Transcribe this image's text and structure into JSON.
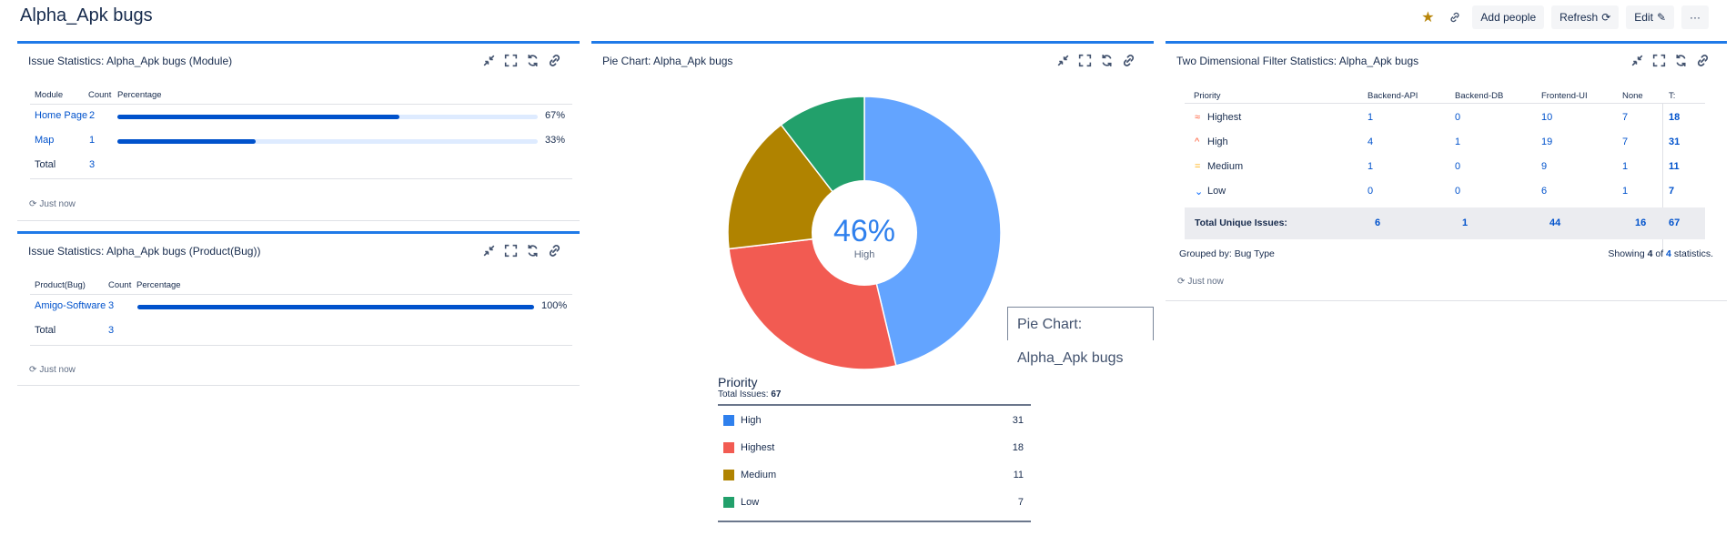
{
  "dashboard": {
    "title": "Alpha_Apk bugs",
    "actions": {
      "add_people": "Add people",
      "refresh": "Refresh",
      "edit": "Edit",
      "more": "···"
    }
  },
  "colors": {
    "accent": "#1f7ae8",
    "link": "#0052cc",
    "high": "#63a4ff",
    "highest": "#f25b52",
    "medium": "#b08300",
    "low": "#22a06b",
    "star": "#b8860b"
  },
  "module_stats": {
    "title": "Issue Statistics: Alpha_Apk bugs (Module)",
    "headers": {
      "col1": "Module",
      "col2": "Count",
      "col3": "Percentage"
    },
    "rows": [
      {
        "name": "Home Page",
        "count": "2",
        "percent_label": "67%",
        "percent": 67
      },
      {
        "name": "Map",
        "count": "1",
        "percent_label": "33%",
        "percent": 33
      }
    ],
    "total_label": "Total",
    "total_count": "3",
    "updated": "Just now"
  },
  "product_stats": {
    "title": "Issue Statistics: Alpha_Apk bugs (Product(Bug))",
    "headers": {
      "col1": "Product(Bug)",
      "col2": "Count",
      "col3": "Percentage"
    },
    "rows": [
      {
        "name": "Amigo-Software",
        "count": "3",
        "percent_label": "100%",
        "percent": 100
      }
    ],
    "total_label": "Total",
    "total_count": "3",
    "updated": "Just now"
  },
  "pie": {
    "title": "Pie Chart: Alpha_Apk bugs",
    "center_value": "46%",
    "center_label": "High",
    "tooltip": "Pie Chart: Alpha_Apk bugs",
    "legend_title": "Priority",
    "total_label": "Total Issues:",
    "total_value": "67",
    "legend": [
      {
        "label": "High",
        "count": "31"
      },
      {
        "label": "Highest",
        "count": "18"
      },
      {
        "label": "Medium",
        "count": "11"
      },
      {
        "label": "Low",
        "count": "7"
      }
    ]
  },
  "chart_data": {
    "type": "pie",
    "title": "Pie Chart: Alpha_Apk bugs",
    "categories": [
      "High",
      "Highest",
      "Medium",
      "Low"
    ],
    "values": [
      31,
      18,
      11,
      7
    ],
    "colors": [
      "#63a4ff",
      "#f25b52",
      "#b08300",
      "#22a06b"
    ],
    "legend_title": "Priority",
    "total": 67
  },
  "two_d": {
    "title": "Two Dimensional Filter Statistics: Alpha_Apk bugs",
    "headers": [
      "Priority",
      "Backend-API",
      "Backend-DB",
      "Frontend-UI",
      "None",
      "T:"
    ],
    "rows": [
      {
        "priority": "Highest",
        "icon": "highest-priority-icon",
        "values": [
          "1",
          "0",
          "10",
          "7",
          "18"
        ]
      },
      {
        "priority": "High",
        "icon": "high-priority-icon",
        "values": [
          "4",
          "1",
          "19",
          "7",
          "31"
        ]
      },
      {
        "priority": "Medium",
        "icon": "medium-priority-icon",
        "values": [
          "1",
          "0",
          "9",
          "1",
          "11"
        ]
      },
      {
        "priority": "Low",
        "icon": "low-priority-icon",
        "values": [
          "0",
          "0",
          "6",
          "1",
          "7"
        ]
      }
    ],
    "total_label": "Total Unique Issues:",
    "totals": [
      "6",
      "1",
      "44",
      "16",
      "67"
    ],
    "grouped_by": "Grouped by: Bug Type",
    "showing_prefix": "Showing",
    "showing_a": "4",
    "showing_of": "of",
    "showing_b": "4",
    "showing_suffix": "statistics.",
    "updated": "Just now"
  }
}
